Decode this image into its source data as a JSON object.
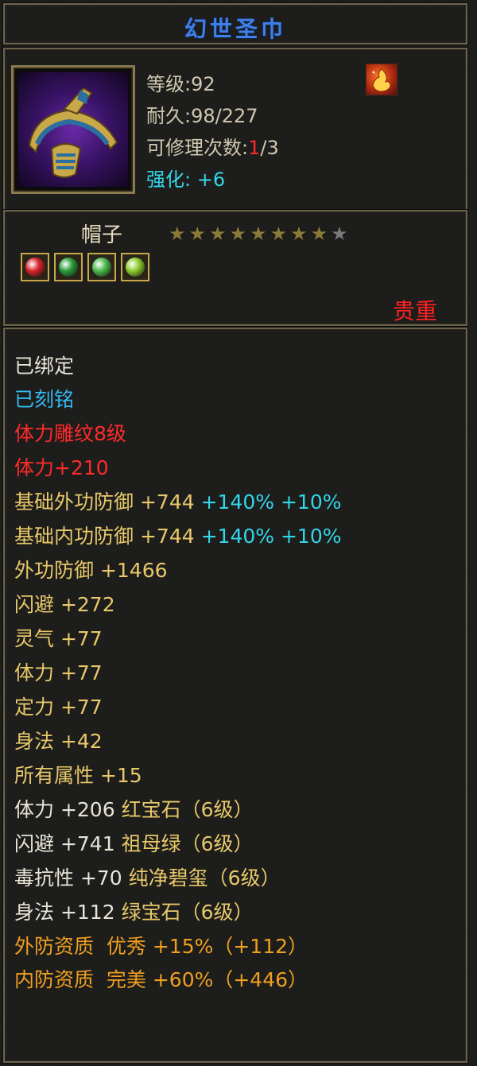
{
  "item": {
    "name": "幻世圣巾",
    "level_label": "等级:92",
    "durability_label": "耐久:98/227",
    "repair_prefix": "可修理次数:",
    "repair_used": "1",
    "repair_total": "/3",
    "enhance_label": "强化: +6",
    "type": "帽子",
    "rarity": "贵重",
    "stars_filled": 8,
    "stars_total": 9
  },
  "colors": {
    "title": "#3f7fe8",
    "bound": "#e8e4d8",
    "engraved": "#33b8f0",
    "red": "#ff2a2a",
    "gold": "#e8c86a",
    "cyan": "#33d6e8",
    "orange": "#f0a020"
  },
  "gems": [
    {
      "name": "ruby-gem-icon",
      "color": "#d8222a"
    },
    {
      "name": "emerald-gem-icon",
      "color": "#2a9a3a"
    },
    {
      "name": "jade-gem-icon",
      "color": "#4ab84a"
    },
    {
      "name": "green-gem-icon",
      "color": "#8acb2a"
    }
  ],
  "attributes": {
    "bound": "已绑定",
    "engraved": "已刻铭",
    "vitality_engrave": "体力雕纹8级",
    "vitality_bonus": "体力+210",
    "base_outer_def_label": "基础外功防御",
    "base_outer_def_value": "+744",
    "base_outer_def_pct1": "+140%",
    "base_outer_def_pct2": "+10%",
    "base_inner_def_label": "基础内功防御",
    "base_inner_def_value": "+744",
    "base_inner_def_pct1": "+140%",
    "base_inner_def_pct2": "+10%",
    "outer_def": "外功防御 +1466",
    "dodge": "闪避 +272",
    "spirit": "灵气 +77",
    "vitality": "体力 +77",
    "focus": "定力 +77",
    "agility": "身法 +42",
    "all_attr": "所有属性 +15",
    "gem1_stat": "体力 +206",
    "gem1_name": "红宝石（6级）",
    "gem2_stat": "闪避 +741",
    "gem2_name": "祖母绿（6级）",
    "gem3_stat": "毒抗性 +70",
    "gem3_name": "纯净碧玺（6级）",
    "gem4_stat": "身法 +112",
    "gem4_name": "绿宝石（6级）",
    "outer_quality": "外防资质  优秀 +15%（+112）",
    "inner_quality": "内防资质  完美 +60%（+446）"
  }
}
